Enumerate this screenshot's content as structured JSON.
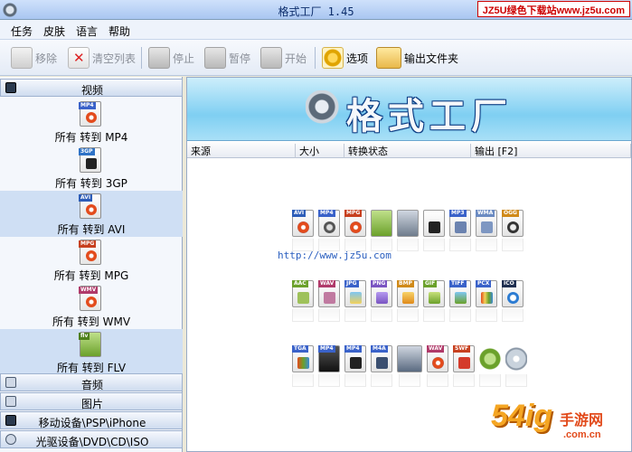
{
  "window": {
    "title": "格式工厂 1.45",
    "watermark_text": "JZ5U绿色下载站www.jz5u.com"
  },
  "menu": [
    "任务",
    "皮肤",
    "语言",
    "帮助"
  ],
  "toolbar": {
    "remove": "移除",
    "clear_list": "清空列表",
    "stop": "停止",
    "pause": "暂停",
    "start": "开始",
    "options": "选项",
    "output_folder": "输出文件夹"
  },
  "left_panel": {
    "video_header": "视频",
    "video_items": [
      {
        "tag": "MP4",
        "tag_color": "#3a62c9",
        "label": "所有 转到 MP4"
      },
      {
        "tag": "3GP",
        "tag_color": "#2f73c6",
        "label": "所有 转到 3GP"
      },
      {
        "tag": "AVI",
        "tag_color": "#2d5db8",
        "label": "所有 转到 AVI"
      },
      {
        "tag": "MPG",
        "tag_color": "#c7401f",
        "label": "所有 转到 MPG"
      },
      {
        "tag": "WMV",
        "tag_color": "#b03a6a",
        "label": "所有 转到 WMV"
      },
      {
        "tag": "flv",
        "tag_color": "#6ba12b",
        "label": "所有 转到 FLV"
      }
    ],
    "audio_header": "音频",
    "image_header": "图片",
    "mobile_header": "移动设备\\PSP\\iPhone",
    "rom_header": "光驱设备\\DVD\\CD\\ISO"
  },
  "right_panel": {
    "banner_title": "格式工厂",
    "columns": [
      "来源",
      "大小",
      "转换状态",
      "输出 [F2]"
    ],
    "url": "http://www.jz5u.com",
    "row1_tags": [
      "AVI",
      "MP4",
      "MPG",
      "",
      "",
      "",
      "MP3",
      "WMA",
      "OGG"
    ],
    "row2_tags": [
      "AAC",
      "WAV",
      "JPG",
      "PNG",
      "BMP",
      "GIF",
      "TIFF",
      "PCX",
      "ICO"
    ],
    "row3_tags": [
      "TGA",
      "MP4",
      "MP4",
      "M4A",
      "",
      "WAV",
      "SWF",
      "",
      ""
    ]
  },
  "watermark_bottom": {
    "big": "54ig",
    "side": "手游网",
    "domain": ".com.cn"
  }
}
